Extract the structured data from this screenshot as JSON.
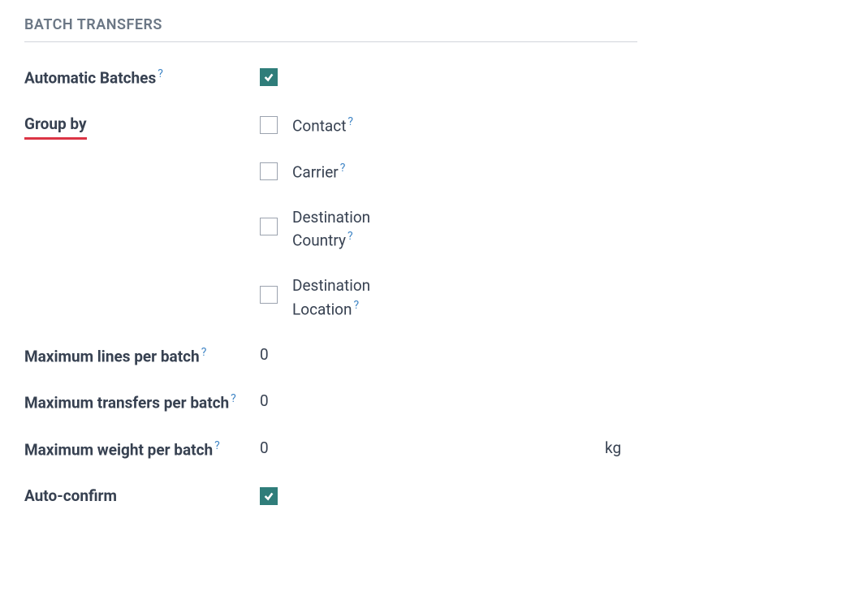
{
  "section_title": "BATCH TRANSFERS",
  "fields": {
    "automatic_batches": {
      "label": "Automatic Batches",
      "checked": true
    },
    "group_by": {
      "label": "Group by",
      "options": [
        {
          "label": "Contact",
          "checked": false,
          "help": true
        },
        {
          "label": "Carrier",
          "checked": false,
          "help": true
        },
        {
          "label": "Destination Country",
          "checked": false,
          "help": true
        },
        {
          "label": "Destination Location",
          "checked": false,
          "help": true
        }
      ]
    },
    "max_lines": {
      "label": "Maximum lines per batch",
      "value": "0"
    },
    "max_transfers": {
      "label": "Maximum transfers per batch",
      "value": "0"
    },
    "max_weight": {
      "label": "Maximum weight per batch",
      "value": "0",
      "unit": "kg"
    },
    "auto_confirm": {
      "label": "Auto-confirm",
      "checked": true
    }
  },
  "help_symbol": "?"
}
